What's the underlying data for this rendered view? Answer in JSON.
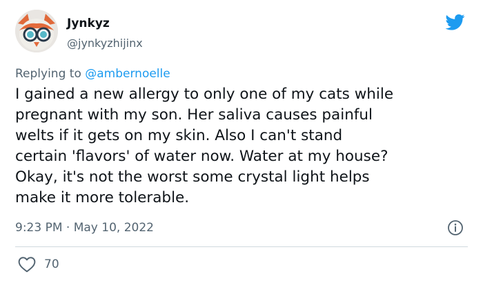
{
  "author": {
    "name": "Jynkyz",
    "handle": "@jynkyzhijinx"
  },
  "reply": {
    "prefix": "Replying to ",
    "mention": "@ambernoelle"
  },
  "body": [
    "I gained a new allergy to only one of my cats while",
    "pregnant with my son. Her saliva causes painful",
    "welts if it gets on my skin. Also I can't stand",
    "certain 'flavors' of water now. Water at my house?",
    "Okay, it's not the worst some crystal light helps",
    "make it more tolerable."
  ],
  "timestamp": "9:23 PM · May 10, 2022",
  "likes": "70",
  "icons": {
    "logo": "twitter-bird-icon",
    "info": "info-icon",
    "like": "heart-icon"
  },
  "colors": {
    "accent": "#1d9bf0",
    "secondary_text": "#536471",
    "primary_text": "#0f1419",
    "divider": "#cfd9de"
  }
}
